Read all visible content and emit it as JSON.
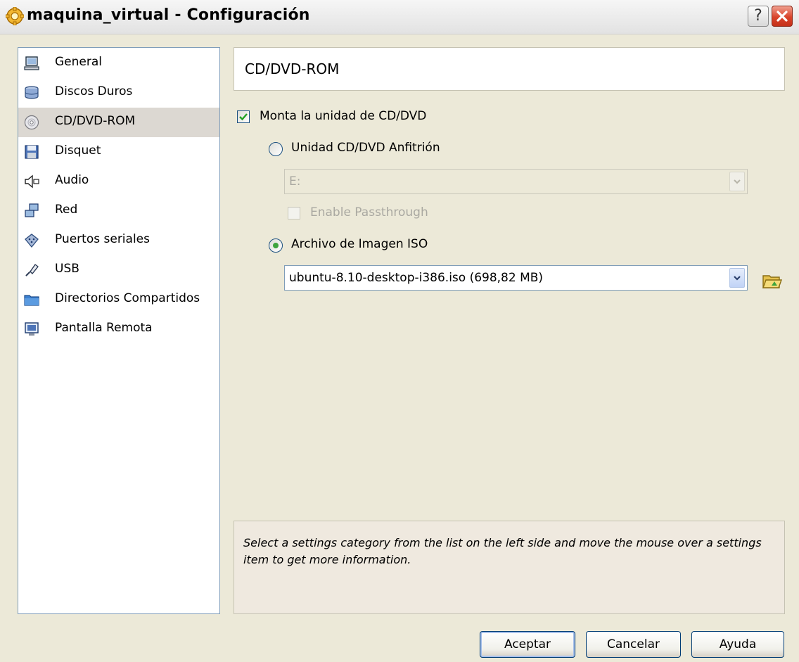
{
  "window": {
    "title": "maquina_virtual - Configuración",
    "help_label": "?",
    "app_icon": "gear-icon",
    "close_icon": "close-icon"
  },
  "sidebar": {
    "items": [
      {
        "label": "General",
        "icon": "computer-icon"
      },
      {
        "label": "Discos Duros",
        "icon": "hard-disk-icon"
      },
      {
        "label": "CD/DVD-ROM",
        "icon": "cd-icon",
        "selected": true
      },
      {
        "label": "Disquet",
        "icon": "floppy-icon"
      },
      {
        "label": "Audio",
        "icon": "speaker-icon"
      },
      {
        "label": "Red",
        "icon": "network-icon"
      },
      {
        "label": "Puertos seriales",
        "icon": "serial-port-icon"
      },
      {
        "label": "USB",
        "icon": "usb-icon"
      },
      {
        "label": "Directorios Compartidos",
        "icon": "folder-icon"
      },
      {
        "label": "Pantalla Remota",
        "icon": "monitor-icon"
      }
    ]
  },
  "main": {
    "page_title": "CD/DVD-ROM",
    "mount_checkbox": {
      "label": "Monta la unidad de CD/DVD",
      "checked": true
    },
    "host_drive_radio": {
      "label": "Unidad CD/DVD Anfitrión",
      "checked": false
    },
    "host_drive_select": {
      "value": "E:",
      "enabled": false
    },
    "passthrough_checkbox": {
      "label": "Enable Passthrough",
      "checked": false,
      "enabled": false
    },
    "iso_radio": {
      "label": "Archivo de Imagen ISO",
      "checked": true
    },
    "iso_select": {
      "value": "ubuntu-8.10-desktop-i386.iso (698,82 MB)"
    },
    "iso_browse_icon": "open-folder-icon"
  },
  "info": {
    "text": "Select a settings category from the list on the left side and move the mouse over a settings item to get more information."
  },
  "buttons": {
    "ok": "Aceptar",
    "cancel": "Cancelar",
    "help": "Ayuda"
  },
  "colors": {
    "selection": "#dcd8d2",
    "radio_dot": "#3ea43e",
    "checkmark": "#21a121",
    "close_red": "#d9442b"
  }
}
